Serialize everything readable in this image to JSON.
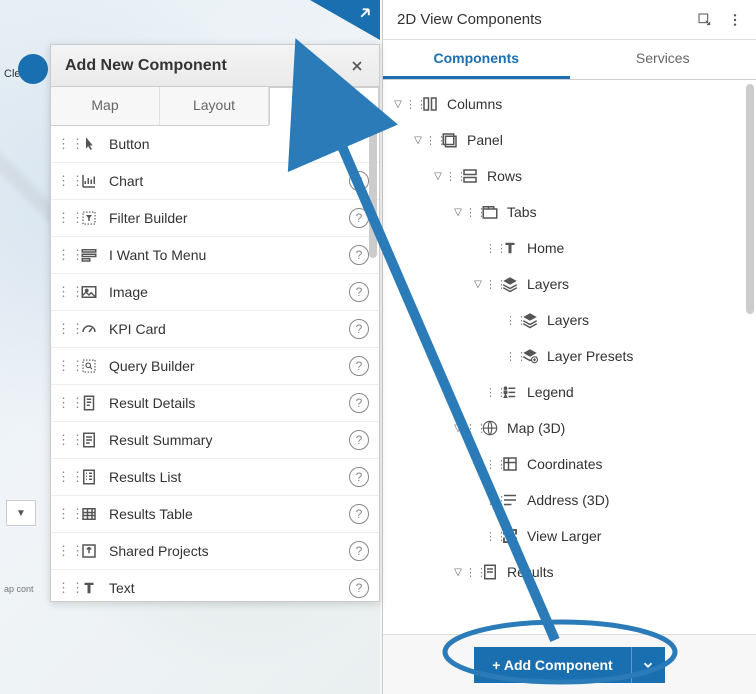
{
  "map": {
    "clear_label": "Clear",
    "credits": "ap cont"
  },
  "corner": {
    "icon": "open-external"
  },
  "add_panel": {
    "title": "Add New Component",
    "tabs": [
      "Map",
      "Layout",
      "Other"
    ],
    "active_tab": 2,
    "items": [
      {
        "icon": "pointer",
        "label": "Button",
        "help": false
      },
      {
        "icon": "chart",
        "label": "Chart",
        "help": true
      },
      {
        "icon": "filter",
        "label": "Filter Builder",
        "help": true
      },
      {
        "icon": "menu",
        "label": "I Want To Menu",
        "help": true
      },
      {
        "icon": "image",
        "label": "Image",
        "help": true
      },
      {
        "icon": "gauge",
        "label": "KPI Card",
        "help": true
      },
      {
        "icon": "query",
        "label": "Query Builder",
        "help": true
      },
      {
        "icon": "details",
        "label": "Result Details",
        "help": true
      },
      {
        "icon": "summary",
        "label": "Result Summary",
        "help": true
      },
      {
        "icon": "list",
        "label": "Results List",
        "help": true
      },
      {
        "icon": "table",
        "label": "Results Table",
        "help": true
      },
      {
        "icon": "share",
        "label": "Shared Projects",
        "help": true
      },
      {
        "icon": "text",
        "label": "Text",
        "help": true
      }
    ]
  },
  "right_panel": {
    "title": "2D View Components",
    "tabs": [
      "Components",
      "Services"
    ],
    "active_tab": 0,
    "tree": [
      {
        "depth": 0,
        "exp": "v",
        "icon": "columns",
        "label": "Columns"
      },
      {
        "depth": 1,
        "exp": "v",
        "icon": "panel",
        "label": "Panel"
      },
      {
        "depth": 2,
        "exp": "v",
        "icon": "rows",
        "label": "Rows"
      },
      {
        "depth": 3,
        "exp": "v",
        "icon": "tabs",
        "label": "Tabs"
      },
      {
        "depth": 4,
        "exp": "",
        "icon": "text",
        "label": "Home"
      },
      {
        "depth": 4,
        "exp": "v",
        "icon": "layers",
        "label": "Layers"
      },
      {
        "depth": 5,
        "exp": "",
        "icon": "layers",
        "label": "Layers"
      },
      {
        "depth": 5,
        "exp": "",
        "icon": "presets",
        "label": "Layer Presets"
      },
      {
        "depth": 4,
        "exp": "",
        "icon": "legend",
        "label": "Legend"
      },
      {
        "depth": 3,
        "exp": "v",
        "icon": "map3d",
        "label": "Map (3D)"
      },
      {
        "depth": 4,
        "exp": "",
        "icon": "coords",
        "label": "Coordinates"
      },
      {
        "depth": 4,
        "exp": "",
        "icon": "address",
        "label": "Address (3D)"
      },
      {
        "depth": 4,
        "exp": "",
        "icon": "expand",
        "label": "View Larger"
      },
      {
        "depth": 3,
        "exp": "v",
        "icon": "results",
        "label": "Results"
      }
    ],
    "add_button": "+ Add Component"
  }
}
